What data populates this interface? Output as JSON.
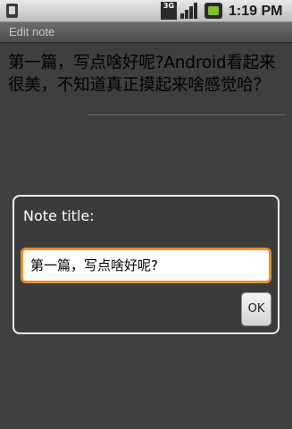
{
  "status_bar": {
    "network_label": "3G",
    "time": "1:19 PM",
    "icons": [
      "sim-card-icon",
      "3g-icon",
      "signal-icon",
      "battery-icon"
    ]
  },
  "title_bar": {
    "title": "Edit note"
  },
  "editor": {
    "text": "第一篇，写点啥好呢?Android看起来很美，不知道真正摸起来啥感觉哈？"
  },
  "dialog": {
    "label": "Note title:",
    "input_value": "第一篇，写点啥好呢?",
    "ok_label": "OK"
  },
  "colors": {
    "focus_border": "#e6922b",
    "background": "#3f3f3f"
  }
}
